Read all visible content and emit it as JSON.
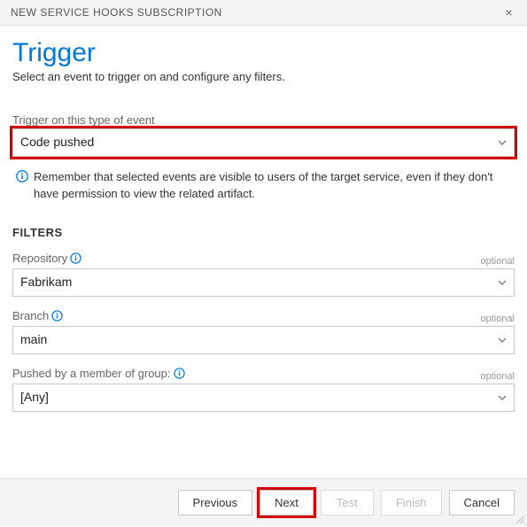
{
  "header": {
    "title": "NEW SERVICE HOOKS SUBSCRIPTION"
  },
  "page": {
    "title": "Trigger",
    "subtitle": "Select an event to trigger on and configure any filters."
  },
  "trigger_event": {
    "label": "Trigger on this type of event",
    "value": "Code pushed"
  },
  "info_message": "Remember that selected events are visible to users of the target service, even if they don't have permission to view the related artifact.",
  "filters": {
    "heading": "FILTERS",
    "optional_text": "optional",
    "repository": {
      "label": "Repository",
      "value": "Fabrikam"
    },
    "branch": {
      "label": "Branch",
      "value": "main"
    },
    "group": {
      "label": "Pushed by a member of group:",
      "value": "[Any]"
    }
  },
  "buttons": {
    "previous": "Previous",
    "next": "Next",
    "test": "Test",
    "finish": "Finish",
    "cancel": "Cancel"
  }
}
